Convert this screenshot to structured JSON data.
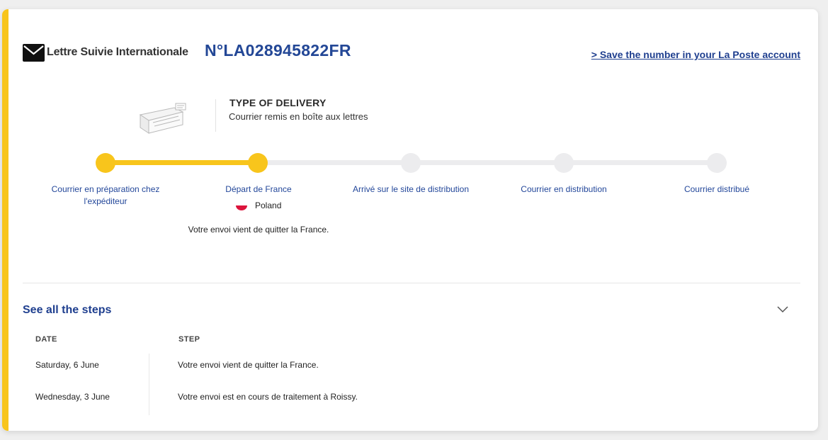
{
  "header": {
    "product_name": "Lettre Suivie Internationale",
    "tracking_number": "N°LA028945822FR",
    "save_link": "> Save the number in your La Poste account"
  },
  "delivery": {
    "title": "TYPE OF DELIVERY",
    "subtitle": "Courrier remis en boîte aux lettres"
  },
  "timeline": {
    "progress_fraction": 0.25,
    "steps": [
      {
        "label": "Courrier en préparation chez l'expéditeur",
        "state": "done"
      },
      {
        "label": "Départ de France",
        "state": "current"
      },
      {
        "label": "Arrivé sur le site de distribution",
        "state": "pending"
      },
      {
        "label": "Courrier en distribution",
        "state": "pending"
      },
      {
        "label": "Courrier distribué",
        "state": "pending"
      }
    ],
    "current_country": "Poland",
    "current_description": "Votre envoi vient de quitter la France."
  },
  "steps_section": {
    "title": "See all the steps",
    "columns": {
      "date": "DATE",
      "step": "STEP"
    },
    "rows": [
      {
        "date": "Saturday, 6 June",
        "step": "Votre envoi vient de quitter la France."
      },
      {
        "date": "Wednesday, 3 June",
        "step": "Votre envoi est en cours de traitement à Roissy."
      }
    ]
  },
  "icons": {
    "envelope": "envelope-icon",
    "mailbox": "mailbox-illustration",
    "flag": "poland-flag-icon",
    "chevron": "chevron-down-icon"
  },
  "colors": {
    "accent_yellow": "#f8c51c",
    "brand_blue": "#234796",
    "inactive_grey": "#ececee"
  }
}
